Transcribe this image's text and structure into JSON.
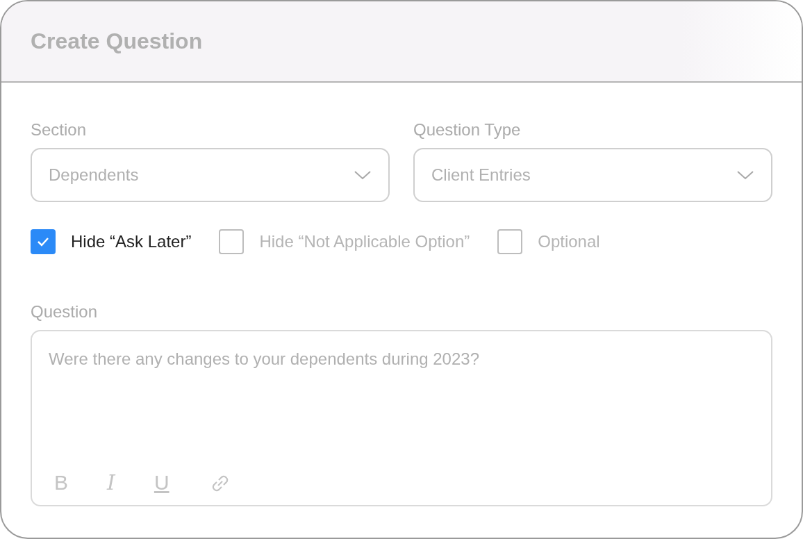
{
  "title": "Create Question",
  "fields": [
    {
      "label": "Section",
      "value": "Dependents"
    },
    {
      "label": "Question Type",
      "value": "Client Entries"
    }
  ],
  "options": [
    {
      "label": "Hide “Ask Later”",
      "checked": true
    },
    {
      "label": "Hide “Not Applicable Option”",
      "checked": false
    },
    {
      "label": "Optional",
      "checked": false
    }
  ],
  "question": {
    "label": "Question",
    "placeholder": "Were there any changes to your dependents during 2023?",
    "toolbar": [
      {
        "kind": "bold",
        "label": "B"
      },
      {
        "kind": "italic",
        "label": "I"
      },
      {
        "kind": "underline",
        "label": "U"
      },
      {
        "kind": "link"
      }
    ]
  }
}
